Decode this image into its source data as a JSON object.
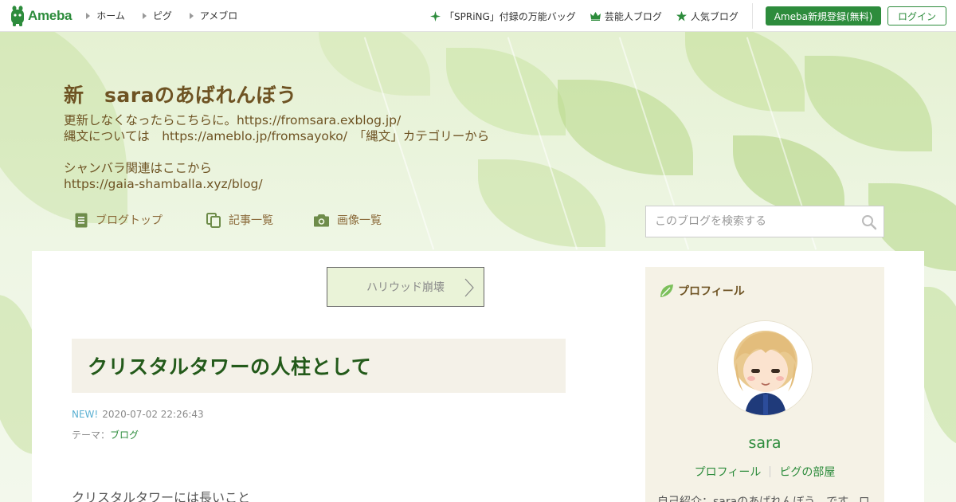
{
  "topbar": {
    "logo_text": "Ameba",
    "nav": [
      {
        "label": "ホーム"
      },
      {
        "label": "ピグ"
      },
      {
        "label": "アメブロ"
      }
    ],
    "right_links": [
      {
        "label": "「SPRiNG」付録の万能バッグ",
        "icon": "sparkle-icon"
      },
      {
        "label": "芸能人ブログ",
        "icon": "crown-icon"
      },
      {
        "label": "人気ブログ",
        "icon": "star-icon"
      }
    ],
    "register_label": "Ameba新規登録(無料)",
    "login_label": "ログイン"
  },
  "blog": {
    "title": "新　saraのあばれんぼう",
    "description": "更新しなくなったらこちらに。https://fromsara.exblog.jp/\n縄文については　https://ameblo.jp/fromsayoko/　「縄文」カテゴリーから\n\nシャンバラ関連はここから\nhttps://gaia-shamballa.xyz/blog/",
    "tabs": [
      {
        "label": "ブログトップ",
        "icon": "document-icon"
      },
      {
        "label": "記事一覧",
        "icon": "copy-icon"
      },
      {
        "label": "画像一覧",
        "icon": "camera-icon"
      }
    ],
    "search_placeholder": "このブログを検索する"
  },
  "article": {
    "prev_label": "ハリウッド崩壊",
    "title": "クリスタルタワーの人柱として",
    "new_badge": "NEW!",
    "datetime": "2020-07-02 22:26:43",
    "theme_prefix": "テーマ：",
    "theme_link": "ブログ",
    "body_first_line": "クリスタルタワーには長いこと"
  },
  "profile": {
    "heading": "プロフィール",
    "name": "sara",
    "link_profile": "プロフィール",
    "link_room": "ピグの部屋",
    "intro": "自己紹介：saraのあばれんぼう　です。ロ"
  },
  "colors": {
    "brand_green": "#2d8c3c",
    "title_brown": "#6e5323",
    "article_green": "#235a1a",
    "new_blue": "#5ab0d2"
  }
}
